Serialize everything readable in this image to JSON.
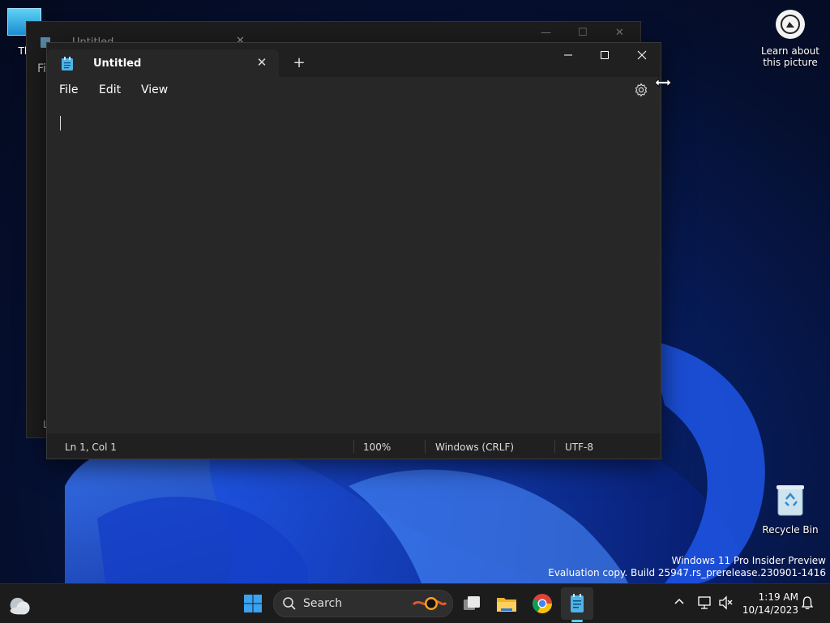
{
  "desktop": {
    "this_pc_label": "Th",
    "learn_label": "Learn about this picture",
    "recycle_label": "Recycle Bin",
    "watermark_line1": "Windows 11 Pro Insider Preview",
    "watermark_line2": "Evaluation copy. Build 25947.rs_prerelease.230901-1416"
  },
  "back_window": {
    "tab_title": "Untitled",
    "menu_partial": "Fil",
    "status_partial": "L"
  },
  "notepad": {
    "tab_title": "Untitled",
    "close_tab": "✕",
    "new_tab": "+",
    "menu": {
      "file": "File",
      "edit": "Edit",
      "view": "View"
    },
    "status": {
      "position": "Ln 1, Col 1",
      "zoom": "100%",
      "line_ending": "Windows (CRLF)",
      "encoding": "UTF-8"
    }
  },
  "taskbar": {
    "search_placeholder": "Search",
    "time": "1:19 AM",
    "date": "10/14/2023"
  },
  "colors": {
    "accent": "#60cdff",
    "window_bg": "#272727",
    "titlebar_bg": "#202020",
    "taskbar_bg": "#1c1c1c"
  }
}
